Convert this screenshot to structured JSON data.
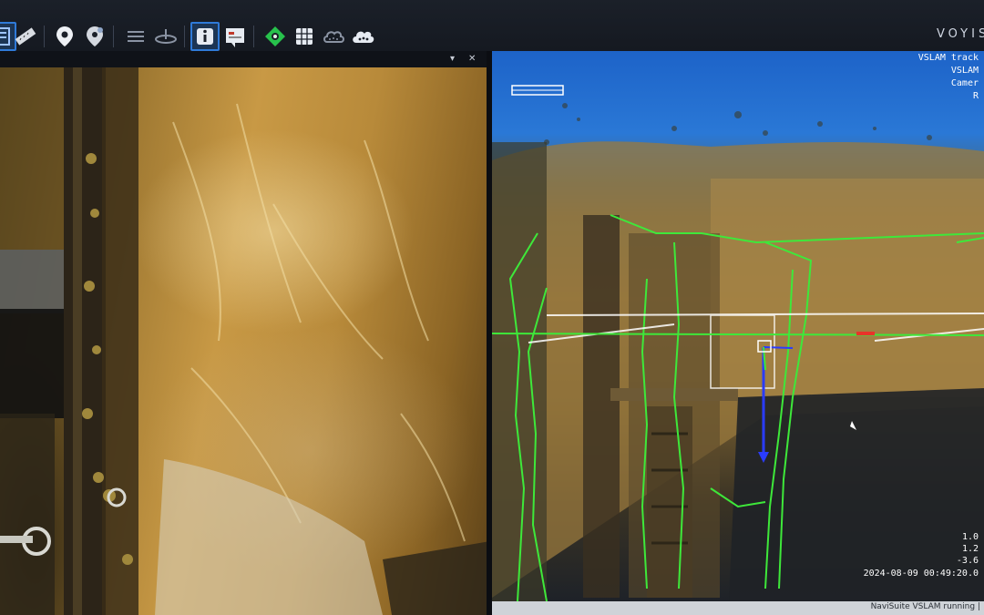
{
  "toolbar": {
    "icons": [
      "layers-icon",
      "ruler-icon",
      "map-pin-icon",
      "map-pin-alt-icon",
      "lines-icon",
      "plane-icon",
      "info-icon",
      "pdf-icon",
      "target-icon",
      "grid-icon",
      "cloud-points-icon",
      "cloud-icon"
    ],
    "brand": "VOYIS"
  },
  "camera_panel": {
    "pin_label": "▾",
    "close_label": "✕"
  },
  "vslam_panel": {
    "overlay": {
      "line1": "VSLAM track",
      "line2": "VSLAM",
      "line3": "Camer",
      "line4": "R"
    },
    "readouts": {
      "value1": "1.0",
      "value2": "1.2",
      "value3": "-3.6"
    },
    "timestamp": "2024-08-09 00:49:20.0",
    "status": "NaviSuite VSLAM running |"
  },
  "colors": {
    "accent": "#2f7ad8",
    "trajectory": "#3ee83a",
    "sky": "#2a78d6",
    "rock": "#b88a3a"
  }
}
